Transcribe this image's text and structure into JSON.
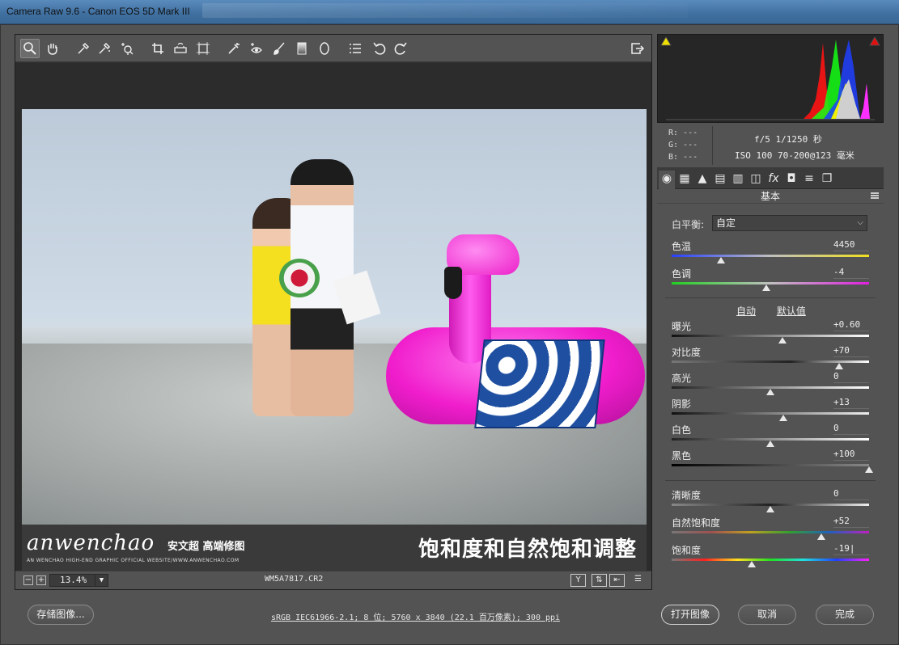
{
  "window": {
    "title": "Camera Raw 9.6 -  Canon EOS 5D Mark III"
  },
  "toolbar": {
    "tools": [
      "zoom-tool",
      "hand-tool",
      "white-balance-tool",
      "color-sampler-tool",
      "targeted-adjustment-tool",
      "crop-tool",
      "straighten-tool",
      "transform-tool",
      "spot-removal-tool",
      "red-eye-tool",
      "adjustment-brush",
      "graduated-filter",
      "radial-filter",
      "preferences",
      "rotate-ccw",
      "rotate-cw",
      "fullscreen-toggle"
    ]
  },
  "watermark": {
    "logo": "anwenchao",
    "cn_name": "安文超 高端修图",
    "tagline": "AN WENCHAO HIGH-END GRAPHIC OFFICIAL WEBSITE/WWW.ANWENCHAO.COM",
    "heading": "饱和度和自然饱和调整"
  },
  "statusbar": {
    "zoom_minus": "−",
    "zoom_plus": "+",
    "zoom": "13.4%",
    "filename": "WM5A7817.CR2",
    "y_icon": "Y"
  },
  "info": {
    "r": "R:  ---",
    "g": "G:  ---",
    "b": "B:  ---",
    "exif_line1": "f/5   1/1250 秒",
    "exif_line2": "ISO 100   70-200@123 毫米"
  },
  "panel": {
    "title": "基本"
  },
  "controls": {
    "wb_label": "白平衡:",
    "wb_value": "自定",
    "auto": "自动",
    "default": "默认值",
    "sliders": [
      {
        "label": "色温",
        "value": "4450",
        "pos": 0.25
      },
      {
        "label": "色调",
        "value": "-4",
        "pos": 0.48
      },
      {
        "label": "曝光",
        "value": "+0.60",
        "pos": 0.56
      },
      {
        "label": "对比度",
        "value": "+70",
        "pos": 0.85
      },
      {
        "label": "高光",
        "value": "0",
        "pos": 0.5
      },
      {
        "label": "阴影",
        "value": "+13",
        "pos": 0.565
      },
      {
        "label": "白色",
        "value": "0",
        "pos": 0.5
      },
      {
        "label": "黑色",
        "value": "+100",
        "pos": 1.0
      },
      {
        "label": "清晰度",
        "value": "0",
        "pos": 0.5
      },
      {
        "label": "自然饱和度",
        "value": "+52",
        "pos": 0.76
      },
      {
        "label": "饱和度",
        "value": "-19|",
        "pos": 0.405
      }
    ]
  },
  "footer": {
    "save": "存储图像...",
    "workflow": "sRGB IEC61966-2.1; 8 位; 5760 x 3840 (22.1 百万像素); 300 ppi",
    "open": "打开图像",
    "cancel": "取消",
    "done": "完成"
  }
}
